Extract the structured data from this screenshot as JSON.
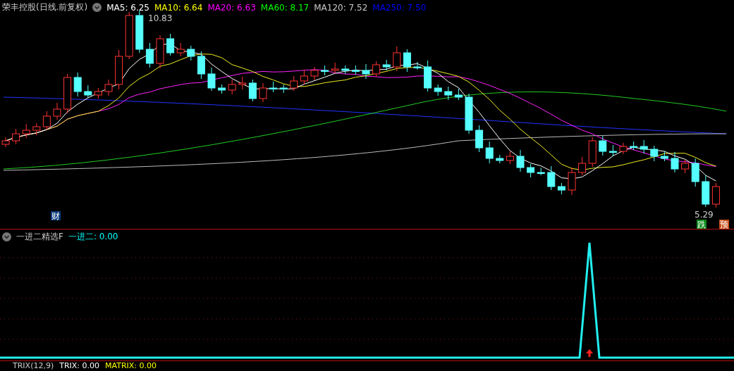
{
  "header": {
    "title": "荣丰控股(日线.前复权)",
    "indicators": [
      {
        "label": "MA5: 6.25",
        "color": "#ffffff"
      },
      {
        "label": "MA10: 6.64",
        "color": "#ffff00"
      },
      {
        "label": "MA20: 6.63",
        "color": "#ff00ff"
      },
      {
        "label": "MA60: 8.17",
        "color": "#00ff00"
      },
      {
        "label": "MA120: 7.52",
        "color": "#c8c8c8"
      },
      {
        "label": "MA250: 7.50",
        "color": "#0000ff"
      }
    ]
  },
  "price_chart": {
    "high_label": "10.83",
    "low_label": "5.29",
    "badges": [
      {
        "text": "财",
        "color": "#0a3a7a"
      },
      {
        "text": "跌",
        "color": "#0a8a1a"
      },
      {
        "text": "预",
        "color": "#c8501a"
      }
    ]
  },
  "indicator_panel": {
    "title": "一进二精选F",
    "values": [
      {
        "label": "一进二: 0.00",
        "color": "#00ffff"
      }
    ]
  },
  "bottom_panel": {
    "title": "TRIX(12,9)",
    "values": [
      {
        "label": "TRIX: 0.00",
        "color": "#ffffff"
      },
      {
        "label": "MATRIX: 0.00",
        "color": "#ffff00"
      }
    ]
  }
}
